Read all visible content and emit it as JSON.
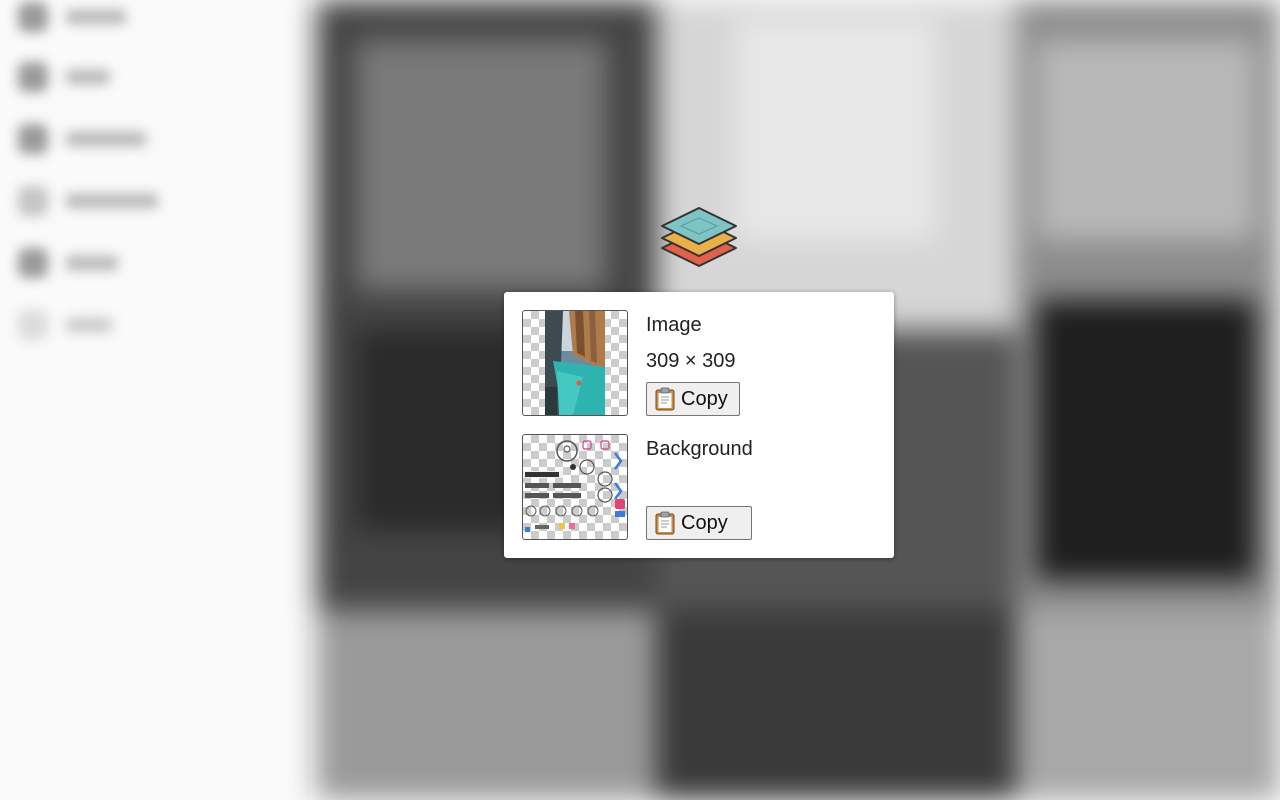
{
  "dialog": {
    "layers": [
      {
        "name": "Image",
        "dimensions": "309 × 309",
        "copy_label": "Copy",
        "thumbnail_icon": "photo-thumbnail"
      },
      {
        "name": "Background",
        "dimensions": "",
        "copy_label": "Copy",
        "thumbnail_icon": "screenshot-thumbnail"
      }
    ]
  },
  "logo": {
    "icon": "layers-icon",
    "colors": [
      "#7fc4c4",
      "#e8b04a",
      "#e2614a"
    ]
  }
}
